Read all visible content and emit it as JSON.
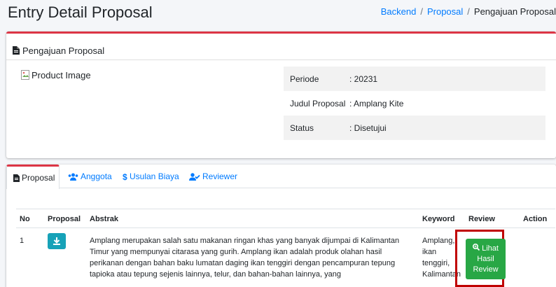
{
  "header": {
    "title": "Entry Detail Proposal",
    "breadcrumb": [
      "Backend",
      "Proposal",
      "Pengajuan Proposal"
    ],
    "breadcrumb_sep": "/"
  },
  "detail_card": {
    "title": "Pengajuan Proposal",
    "image_alt": "Product Image",
    "fields": [
      {
        "label": "Periode",
        "value": ": 20231"
      },
      {
        "label": "Judul Proposal",
        "value": ": Amplang Kite"
      },
      {
        "label": "Status",
        "value": ": Disetujui"
      }
    ]
  },
  "tabs": [
    {
      "label": "Proposal",
      "icon": "file-pdf-icon",
      "active": true
    },
    {
      "label": "Anggota",
      "icon": "users-icon",
      "active": false
    },
    {
      "label": "Usulan Biaya",
      "icon": "dollar-icon",
      "active": false
    },
    {
      "label": "Reviewer",
      "icon": "user-check-icon",
      "active": false
    }
  ],
  "table": {
    "headers": {
      "no": "No",
      "proposal": "Proposal",
      "abstrak": "Abstrak",
      "keyword": "Keyword",
      "review": "Review",
      "action": "Action"
    },
    "rows": [
      {
        "no": "1",
        "abstrak_lines": [
          "Amplang merupakan salah satu makanan ringan khas yang banyak dijumpai di Kalimantan",
          "Timur yang mempunyai citarasa yang gurih. Amplang ikan adalah produk olahan hasil",
          "perikanan dengan bahan baku lumatan daging ikan tenggiri dengan pencampuran tepung",
          "tapioka atau tepung sejenis lainnya, telur, dan bahan-bahan lainnya, yang"
        ],
        "keyword_lines": [
          "Amplang,",
          "ikan",
          "tenggiri,",
          "Kalimantan"
        ],
        "review_button": [
          "Lihat",
          "Hasil",
          "Review"
        ]
      }
    ]
  },
  "colors": {
    "primary": "#007bff",
    "danger": "#dc3545",
    "info": "#17a2b8",
    "success": "#28a745",
    "highlight": "#c00000"
  }
}
